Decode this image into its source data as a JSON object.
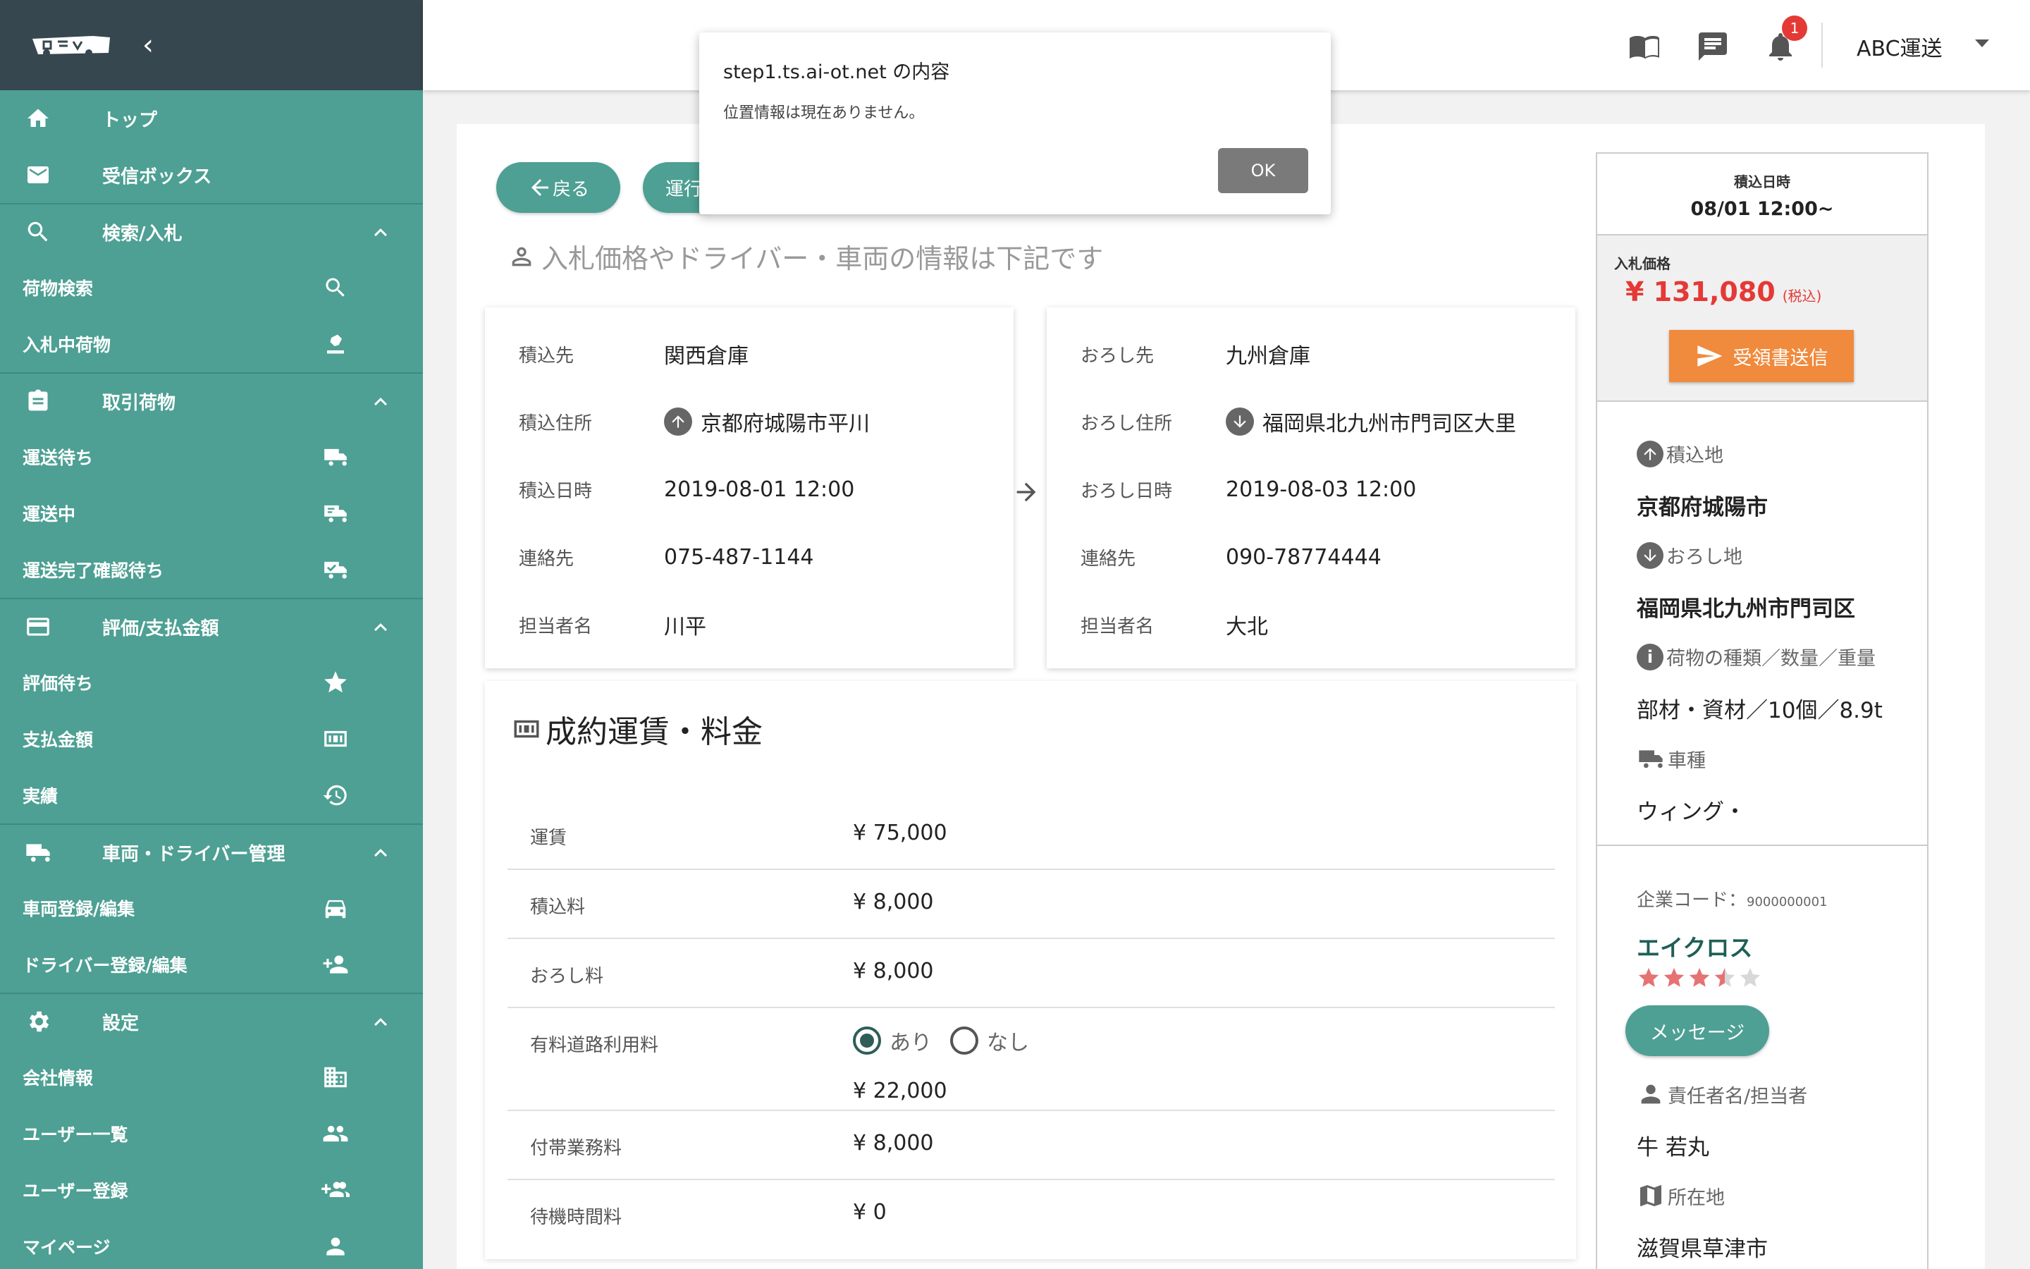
{
  "sidebar": {
    "logo_icon": "truck-logo-icon",
    "items": [
      {
        "label": "トップ",
        "icon": "home-icon"
      },
      {
        "label": "受信ボックス",
        "icon": "mail-icon"
      }
    ],
    "sections": [
      {
        "label": "検索/入札",
        "icon": "search-icon",
        "items": [
          {
            "label": "荷物検索",
            "icon": "search-icon"
          },
          {
            "label": "入札中荷物",
            "icon": "gavel-icon"
          }
        ]
      },
      {
        "label": "取引荷物",
        "icon": "clipboard-icon",
        "items": [
          {
            "label": "運送待ち",
            "icon": "truck-icon"
          },
          {
            "label": "運送中",
            "icon": "truck-moving-icon"
          },
          {
            "label": "運送完了確認待ち",
            "icon": "truck-check-icon"
          }
        ]
      },
      {
        "label": "評価/支払金額",
        "icon": "card-icon",
        "items": [
          {
            "label": "評価待ち",
            "icon": "star-icon"
          },
          {
            "label": "支払金額",
            "icon": "money-icon"
          },
          {
            "label": "実績",
            "icon": "history-icon"
          }
        ]
      },
      {
        "label": "車両・ドライバー管理",
        "icon": "truck-icon",
        "items": [
          {
            "label": "車両登録/編集",
            "icon": "car-icon"
          },
          {
            "label": "ドライバー登録/編集",
            "icon": "person-add-icon"
          }
        ]
      },
      {
        "label": "設定",
        "icon": "gear-icon",
        "items": [
          {
            "label": "会社情報",
            "icon": "building-icon"
          },
          {
            "label": "ユーザー一覧",
            "icon": "people-icon"
          },
          {
            "label": "ユーザー登録",
            "icon": "group-add-icon"
          },
          {
            "label": "マイページ",
            "icon": "person-icon"
          }
        ]
      }
    ]
  },
  "topbar": {
    "notification_count": "1",
    "company": "ABC運送"
  },
  "dialog": {
    "title": "step1.ts.ai-ot.net の内容",
    "message": "位置情報は現在ありません。",
    "ok_label": "OK"
  },
  "main": {
    "back_label": "戻る",
    "operation_label": "運行",
    "info_heading": "入札価格やドライバー・車両の情報は下記です",
    "load": {
      "dest_label": "積込先",
      "dest": "関西倉庫",
      "address_label": "積込住所",
      "address": "京都府城陽市平川",
      "datetime_label": "積込日時",
      "datetime": "2019-08-01 12:00",
      "contact_label": "連絡先",
      "contact": "075-487-1144",
      "person_label": "担当者名",
      "person": "川平"
    },
    "unload": {
      "dest_label": "おろし先",
      "dest": "九州倉庫",
      "address_label": "おろし住所",
      "address": "福岡県北九州市門司区大里",
      "datetime_label": "おろし日時",
      "datetime": "2019-08-03 12:00",
      "contact_label": "連絡先",
      "contact": "090-78774444",
      "person_label": "担当者名",
      "person": "大北"
    },
    "fees": {
      "title": "成約運賃・料金",
      "freight_label": "運賃",
      "freight": "¥ 75,000",
      "loading_label": "積込料",
      "loading": "¥ 8,000",
      "unloading_label": "おろし料",
      "unloading": "¥ 8,000",
      "toll_label": "有料道路利用料",
      "toll_yes": "あり",
      "toll_no": "なし",
      "toll": "¥ 22,000",
      "incidental_label": "付帯業務料",
      "incidental": "¥ 8,000",
      "waiting_label": "待機時間料",
      "waiting": "¥ 0"
    }
  },
  "right_panel": {
    "date_label": "積込日時",
    "date_value": "08/01 12:00~",
    "price_label": "入札価格",
    "price_value": "¥ 131,080",
    "price_tax": "(税込)",
    "receipt_button": "受領書送信",
    "load_place_label": "積込地",
    "load_place": "京都府城陽市",
    "unload_place_label": "おろし地",
    "unload_place": "福岡県北九州市門司区",
    "cargo_label": "荷物の種類／数量／重量",
    "cargo": "部材・資材／10個／8.9t",
    "vehicle_label": "車種",
    "vehicle": "ウィング・",
    "company_code_label": "企業コード：",
    "company_code": "9000000001",
    "company_name": "エイクロス",
    "rating": 3.5,
    "rating_color": "#e57373",
    "message_button": "メッセージ",
    "manager_label": "責任者名/担当者",
    "manager": "牛 若丸",
    "location_label": "所在地",
    "location": "滋賀県草津市"
  }
}
